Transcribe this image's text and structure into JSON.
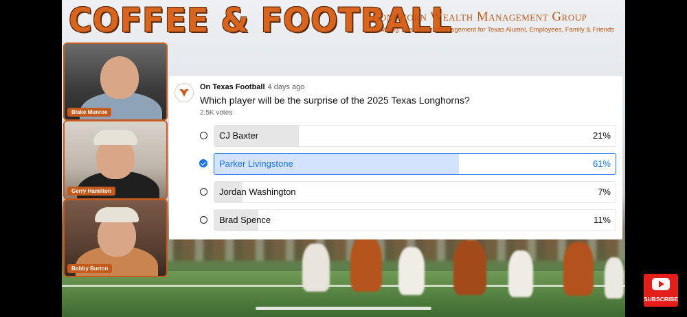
{
  "show": {
    "title": "COFFEE & FOOTBALL"
  },
  "sponsor": {
    "name": "Longhorn Wealth Management Group",
    "tagline": "Providing Total Wealth Management for Texas Alumni, Employees, Family & Friends"
  },
  "participants": [
    {
      "name": "Blake Munroe"
    },
    {
      "name": "Gerry Hamilton"
    },
    {
      "name": "Bobby Burton"
    }
  ],
  "poll": {
    "channel": "On Texas Football",
    "time": "4 days ago",
    "question": "Which player will be the surprise of the 2025 Texas Longhorns?",
    "votes": "2.5K votes",
    "options": [
      {
        "label": "CJ Baxter",
        "percent": "21%",
        "value": 21,
        "selected": false
      },
      {
        "label": "Parker Livingstone",
        "percent": "61%",
        "value": 61,
        "selected": true
      },
      {
        "label": "Jordan Washington",
        "percent": "7%",
        "value": 7,
        "selected": false
      },
      {
        "label": "Brad Spence",
        "percent": "11%",
        "value": 11,
        "selected": false
      }
    ]
  },
  "subscribe": {
    "label": "SUBSCRIBE",
    "icon": "youtube-play-icon"
  },
  "colors": {
    "accent": "#c65a1c",
    "selected": "#1a73e8",
    "subscribe": "#e41e1b"
  }
}
